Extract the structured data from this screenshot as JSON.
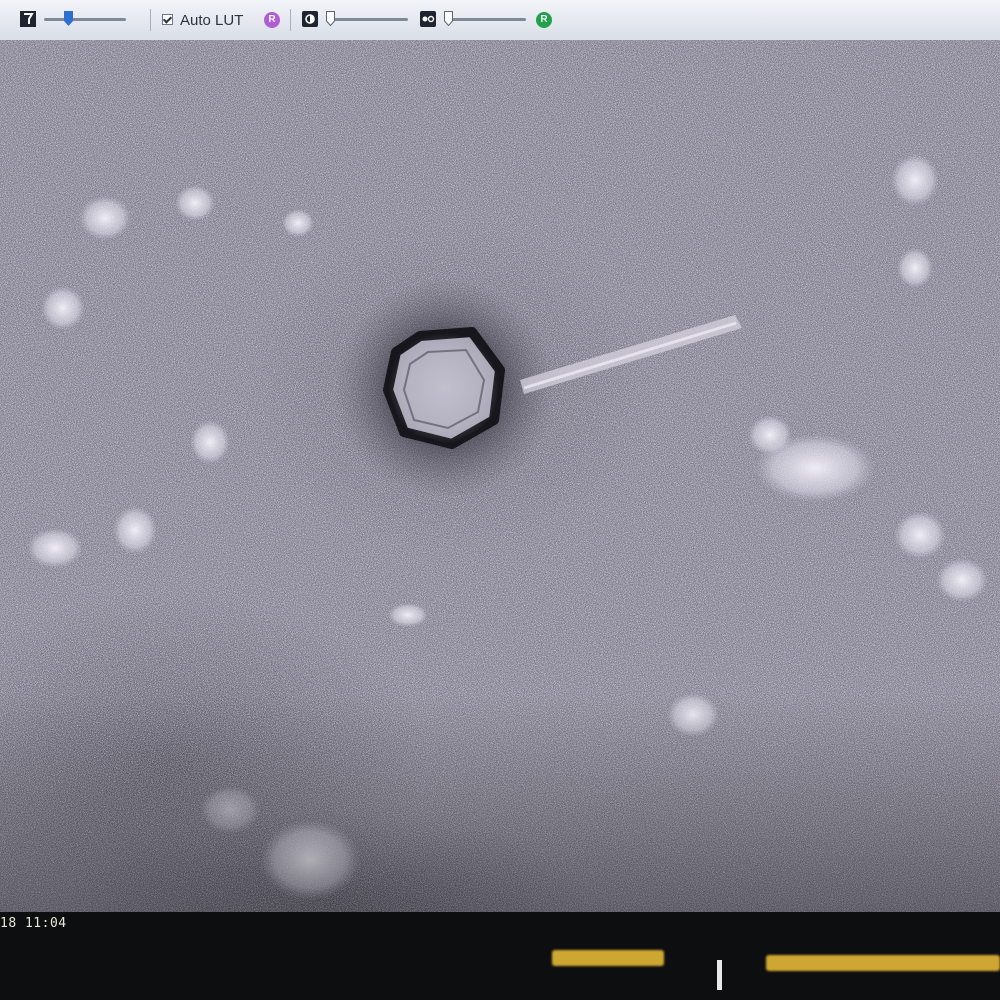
{
  "toolbar": {
    "auto_lut_label": "Auto LUT",
    "auto_lut_checked": true,
    "reset_badge_1": "R",
    "reset_badge_2": "R",
    "colors": {
      "reset_badge_1": "#b25bd6",
      "reset_badge_2": "#1fa24a",
      "slider_thumb": "#2f6fd1"
    },
    "icons": [
      "tool-icon",
      "brightness-icon",
      "contrast-icon"
    ]
  },
  "image": {
    "subject": "micrograph"
  },
  "status": {
    "timestamp": "18 11:04"
  }
}
